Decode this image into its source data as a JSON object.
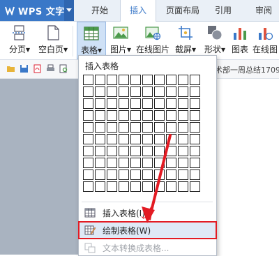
{
  "app": {
    "logo_text": "WPS 文字"
  },
  "tabs": [
    {
      "label": "开始"
    },
    {
      "label": "插入"
    },
    {
      "label": "页面布局"
    },
    {
      "label": "引用"
    },
    {
      "label": "审阅"
    }
  ],
  "ribbon": {
    "page_break": "分页▾",
    "blank_page": "空白页▾",
    "table": "表格▾",
    "picture": "图片▾",
    "online_picture": "在线图片",
    "screenshot": "截屏▾",
    "shape": "形状▾",
    "chart": "图表",
    "online_chart": "在线图"
  },
  "qat": {
    "doc_title": "术部一周总结1709"
  },
  "menu": {
    "title": "插入表格",
    "grid": {
      "rows": 10,
      "cols": 10
    },
    "items": [
      {
        "label": "插入表格(I)"
      },
      {
        "label": "绘制表格(W)"
      },
      {
        "label": "文本转换成表格..."
      }
    ]
  },
  "colors": {
    "accent": "#3a78c8",
    "highlight_border": "#e31b23",
    "arrow": "#e31b23"
  }
}
